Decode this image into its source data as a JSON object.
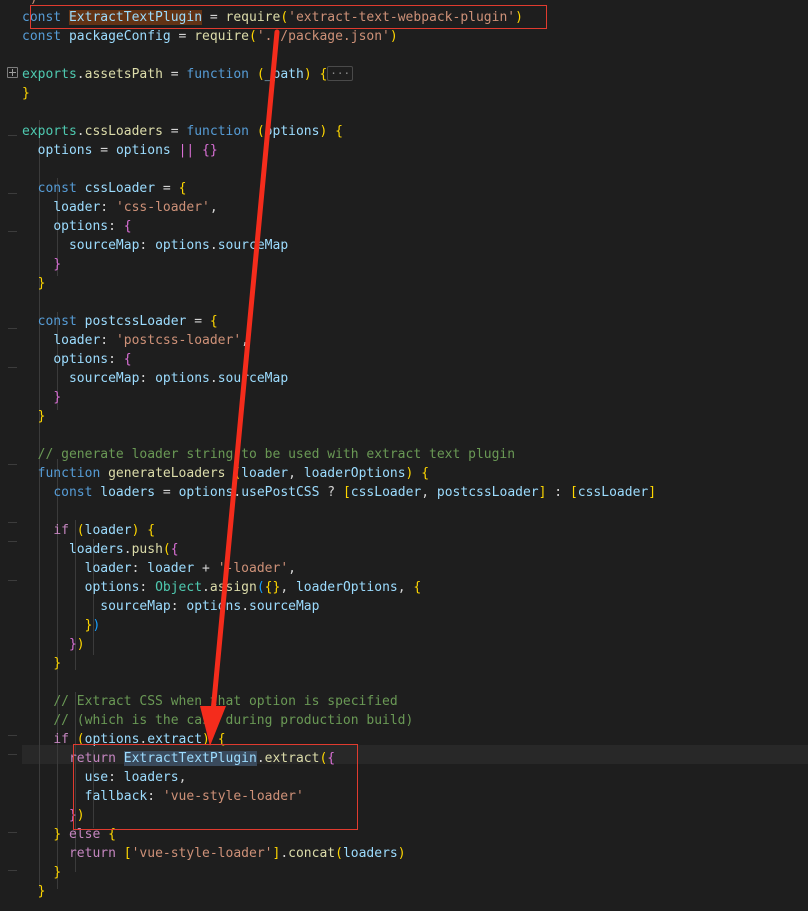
{
  "app": {
    "kind": "code-editor",
    "theme": "dark",
    "background": "#1e1e1e",
    "current_line_background": "#282828",
    "annotation_color": "#e03b2f",
    "find_match_highlight": "#623315",
    "selection_highlight": "#3a4a5c"
  },
  "code": {
    "language": "javascript",
    "lines": [
      {
        "indent": 0,
        "text": "')"
      },
      {
        "indent": 0,
        "text": "const ExtractTextPlugin = require('extract-text-webpack-plugin')"
      },
      {
        "indent": 0,
        "text": "const packageConfig = require('../package.json')"
      },
      {
        "indent": 0,
        "text": ""
      },
      {
        "indent": 0,
        "text": "exports.assetsPath = function (_path) {···"
      },
      {
        "indent": 0,
        "text": "}"
      },
      {
        "indent": 0,
        "text": ""
      },
      {
        "indent": 0,
        "text": "exports.cssLoaders = function (options) {"
      },
      {
        "indent": 1,
        "text": "options = options || {}"
      },
      {
        "indent": 0,
        "text": ""
      },
      {
        "indent": 1,
        "text": "const cssLoader = {"
      },
      {
        "indent": 2,
        "text": "loader: 'css-loader',"
      },
      {
        "indent": 2,
        "text": "options: {"
      },
      {
        "indent": 3,
        "text": "sourceMap: options.sourceMap"
      },
      {
        "indent": 2,
        "text": "}"
      },
      {
        "indent": 1,
        "text": "}"
      },
      {
        "indent": 0,
        "text": ""
      },
      {
        "indent": 1,
        "text": "const postcssLoader = {"
      },
      {
        "indent": 2,
        "text": "loader: 'postcss-loader',"
      },
      {
        "indent": 2,
        "text": "options: {"
      },
      {
        "indent": 3,
        "text": "sourceMap: options.sourceMap"
      },
      {
        "indent": 2,
        "text": "}"
      },
      {
        "indent": 1,
        "text": "}"
      },
      {
        "indent": 0,
        "text": ""
      },
      {
        "indent": 1,
        "text": "// generate loader string to be used with extract text plugin"
      },
      {
        "indent": 1,
        "text": "function generateLoaders (loader, loaderOptions) {"
      },
      {
        "indent": 2,
        "text": "const loaders = options.usePostCSS ? [cssLoader, postcssLoader] : [cssLoader]"
      },
      {
        "indent": 0,
        "text": ""
      },
      {
        "indent": 2,
        "text": "if (loader) {"
      },
      {
        "indent": 3,
        "text": "loaders.push({"
      },
      {
        "indent": 4,
        "text": "loader: loader + '-loader',"
      },
      {
        "indent": 4,
        "text": "options: Object.assign({}, loaderOptions, {"
      },
      {
        "indent": 5,
        "text": "sourceMap: options.sourceMap"
      },
      {
        "indent": 4,
        "text": "})"
      },
      {
        "indent": 3,
        "text": "})"
      },
      {
        "indent": 2,
        "text": "}"
      },
      {
        "indent": 0,
        "text": ""
      },
      {
        "indent": 2,
        "text": "// Extract CSS when that option is specified"
      },
      {
        "indent": 2,
        "text": "// (which is the case during production build)"
      },
      {
        "indent": 2,
        "text": "if (options.extract) {"
      },
      {
        "indent": 3,
        "text": "return ExtractTextPlugin.extract({"
      },
      {
        "indent": 4,
        "text": "use: loaders,"
      },
      {
        "indent": 4,
        "text": "fallback: 'vue-style-loader'"
      },
      {
        "indent": 3,
        "text": "})"
      },
      {
        "indent": 2,
        "text": "} else {"
      },
      {
        "indent": 3,
        "text": "return ['vue-style-loader'].concat(loaders)"
      },
      {
        "indent": 2,
        "text": "}"
      },
      {
        "indent": 1,
        "text": "}"
      }
    ]
  },
  "annotations": {
    "box_top": {
      "label": "require-extract-text-plugin-highlight",
      "target_text": "const ExtractTextPlugin = require('extract-text-webpack-plugin')"
    },
    "box_bottom": {
      "label": "extract-text-plugin-usage-highlight",
      "target_text": "return ExtractTextPlugin.extract({ use: loaders, fallback: 'vue-style-loader' })"
    },
    "arrow": {
      "label": "connector-arrow",
      "direction": "down"
    }
  },
  "folding": {
    "collapsed_marker": "plus-box",
    "collapsed_placeholder": "···",
    "collapsed_line_text": "exports.assetsPath = function (_path) {"
  }
}
